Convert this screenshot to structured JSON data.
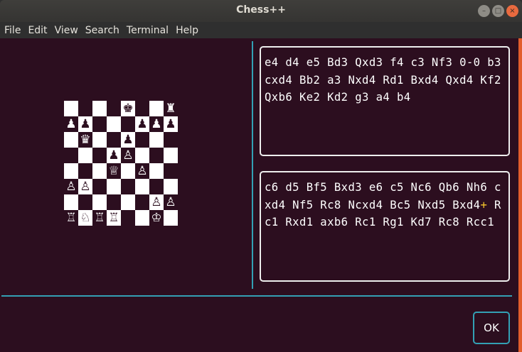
{
  "window": {
    "title": "Chess++",
    "controls": {
      "minimize": "–",
      "maximize": "□",
      "close": "×"
    }
  },
  "menu": [
    "File",
    "Edit",
    "View",
    "Search",
    "Terminal",
    "Help"
  ],
  "board": {
    "rows": [
      [
        "",
        "",
        "",
        "",
        "♚",
        "",
        "",
        "♜"
      ],
      [
        "♟",
        "♟",
        "",
        "",
        "",
        "♟",
        "♟",
        "♟"
      ],
      [
        "",
        "♛",
        "",
        "",
        "♟",
        "",
        "",
        ""
      ],
      [
        "",
        "",
        "",
        "♟",
        "♙",
        "",
        "",
        ""
      ],
      [
        "",
        "",
        "",
        "♕",
        "",
        "♙",
        "",
        ""
      ],
      [
        "♙",
        "♙",
        "",
        "",
        "",
        "",
        "",
        ""
      ],
      [
        "",
        "",
        "",
        "",
        "",
        "",
        "♙",
        "♙"
      ],
      [
        "♖",
        "♘",
        "♖",
        "♖",
        "",
        "",
        "♔",
        ""
      ]
    ]
  },
  "moves": {
    "white": "e4 d4 e5 Bd3 Qxd3 f4 c3 Nf3 0-0 b3 cxd4 Bb2 a3 Nxd4 Rd1 Bxd4 Qxd4 Kf2 Qxb6 Ke2 Kd2 g3 a4 b4",
    "black_before_check": "c6 d5 Bf5 Bxd3 e6 c5 Nc6 Qb6 Nh6 cxd4 Nf5 Rc8 Ncxd4 Bc5 Nxd5 Bxd4",
    "black_check_mark": "+",
    "black_after_check": " Rc1 Rxd1 axb6 Rc1 Rg1 Kd7 Rc8 Rcc1"
  },
  "ok_label": "OK",
  "colors": {
    "background": "#2c0e1f",
    "accent": "#33a0b4",
    "check": "#f6c62c",
    "close_button": "#e96a3f"
  }
}
